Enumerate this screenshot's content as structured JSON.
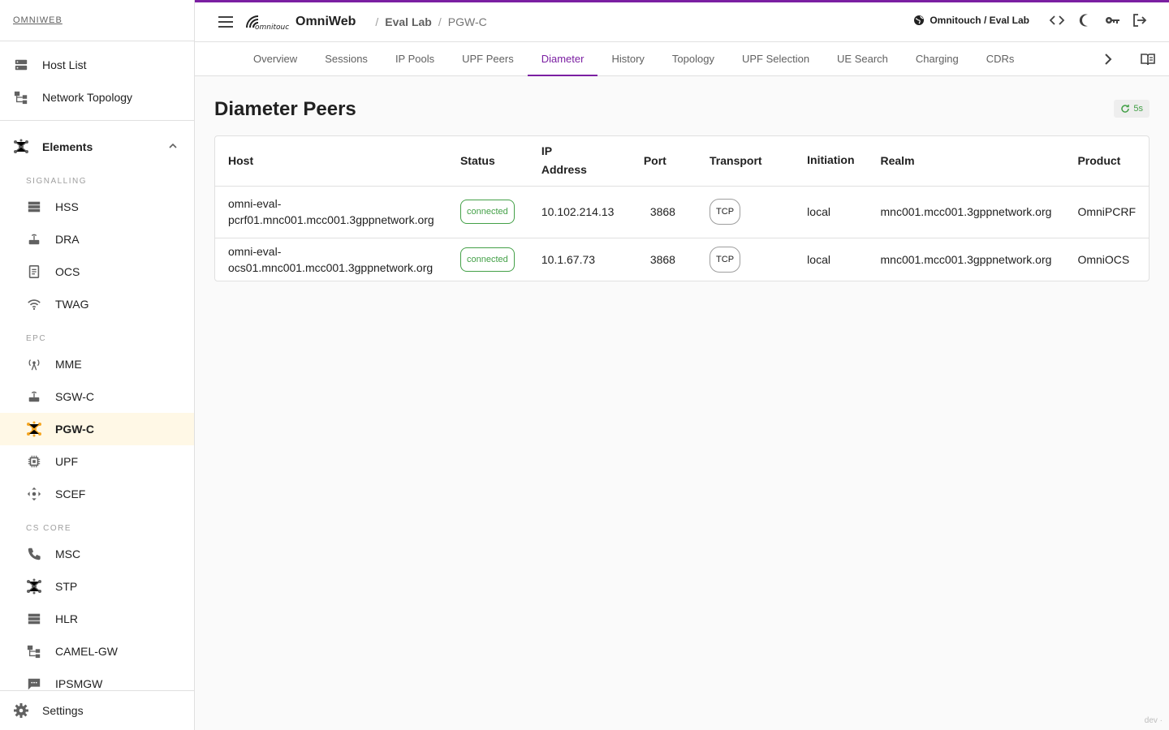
{
  "sidebar": {
    "brand": "OMNIWEB",
    "top_items": [
      {
        "label": "Host List",
        "icon": "host-list-icon"
      },
      {
        "label": "Network Topology",
        "icon": "topology-icon"
      }
    ],
    "group": {
      "label": "Elements",
      "icon": "elements-icon"
    },
    "sections": [
      {
        "label": "SIGNALLING",
        "items": [
          "HSS",
          "DRA",
          "OCS",
          "TWAG"
        ]
      },
      {
        "label": "EPC",
        "items": [
          "MME",
          "SGW-C",
          "PGW-C",
          "UPF",
          "SCEF"
        ]
      },
      {
        "label": "CS CORE",
        "items": [
          "MSC",
          "STP",
          "HLR",
          "CAMEL-GW",
          "IPSMGW"
        ]
      }
    ],
    "active_item": "PGW-C",
    "settings_label": "Settings"
  },
  "header": {
    "app_title": "OmniWeb",
    "breadcrumb": [
      "Eval Lab",
      "PGW-C"
    ],
    "tenant": "Omnitouch / Eval Lab",
    "accent": "#7b1fa2"
  },
  "tabs": [
    "Overview",
    "Sessions",
    "IP Pools",
    "UPF Peers",
    "Diameter",
    "History",
    "Topology",
    "UPF Selection",
    "UE Search",
    "Charging",
    "CDRs"
  ],
  "active_tab": "Diameter",
  "main": {
    "title": "Diameter Peers",
    "refresh_label": "5s",
    "columns": [
      "Host",
      "Status",
      "IP Address",
      "Port",
      "Transport",
      "Initiation",
      "Realm",
      "Product"
    ],
    "rows": [
      {
        "host": "omni-eval-pcrf01.mnc001.mcc001.3gppnetwork.org",
        "status": "connected",
        "ip": "10.102.214.13",
        "port": "3868",
        "transport": "TCP",
        "initiation": "local",
        "realm": "mnc001.mcc001.3gppnetwork.org",
        "product": "OmniPCRF"
      },
      {
        "host": "omni-eval-ocs01.mnc001.mcc001.3gppnetwork.org",
        "status": "connected",
        "ip": "10.1.67.73",
        "port": "3868",
        "transport": "TCP",
        "initiation": "local",
        "realm": "mnc001.mcc001.3gppnetwork.org",
        "product": "OmniOCS"
      }
    ]
  },
  "footer_tag": "dev ·",
  "status_color": "#43a047"
}
